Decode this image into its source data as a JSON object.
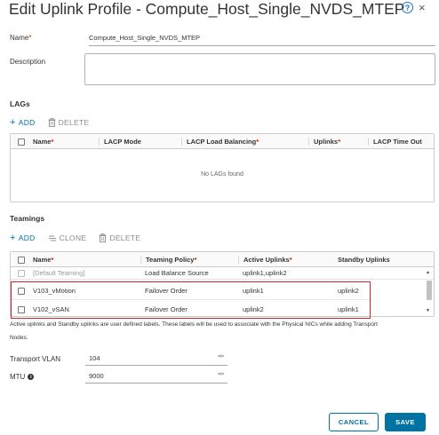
{
  "dialog": {
    "title": "Edit Uplink Profile - Compute_Host_Single_NVDS_MTEP",
    "help_glyph": "?",
    "close_glyph": "×"
  },
  "form": {
    "name_label": "Name",
    "name_value": "Compute_Host_Single_NVDS_MTEP",
    "description_label": "Description",
    "description_value": ""
  },
  "lags": {
    "section_title": "LAGs",
    "add_label": "ADD",
    "delete_label": "DELETE",
    "columns": [
      "Name",
      "LACP Mode",
      "LACP Load Balancing",
      "Uplinks",
      "LACP Time Out"
    ],
    "required_columns": [
      true,
      false,
      true,
      true,
      false
    ],
    "empty_text": "No LAGs found"
  },
  "teamings": {
    "section_title": "Teamings",
    "add_label": "ADD",
    "clone_label": "CLONE",
    "delete_label": "DELETE",
    "columns": [
      "Name",
      "Teaming Policy",
      "Active Uplinks",
      "Standby Uplinks"
    ],
    "required_columns": [
      true,
      true,
      true,
      false
    ],
    "rows": [
      {
        "name": "[Default Teaming]",
        "policy": "Load Balance Source",
        "active": "uplink1,uplink2",
        "standby": ""
      },
      {
        "name": "V103_vMotion",
        "policy": "Failover Order",
        "active": "uplink1",
        "standby": "uplink2"
      },
      {
        "name": "V102_vSAN",
        "policy": "Failover Order",
        "active": "uplink2",
        "standby": "uplink1"
      }
    ]
  },
  "note": {
    "line1": "Active uplinks and Standby uplinks are user defined labels. These labels will be used to associate with the Physical NICs while adding Transport",
    "line2": "Nodes."
  },
  "transport": {
    "vlan_label": "Transport VLAN",
    "vlan_value": "104",
    "mtu_label": "MTU",
    "mtu_value": "9000"
  },
  "footer": {
    "cancel_label": "CANCEL",
    "save_label": "SAVE"
  },
  "colors": {
    "accent": "#0072a3",
    "required": "#c92100",
    "highlight": "#d8232a"
  }
}
